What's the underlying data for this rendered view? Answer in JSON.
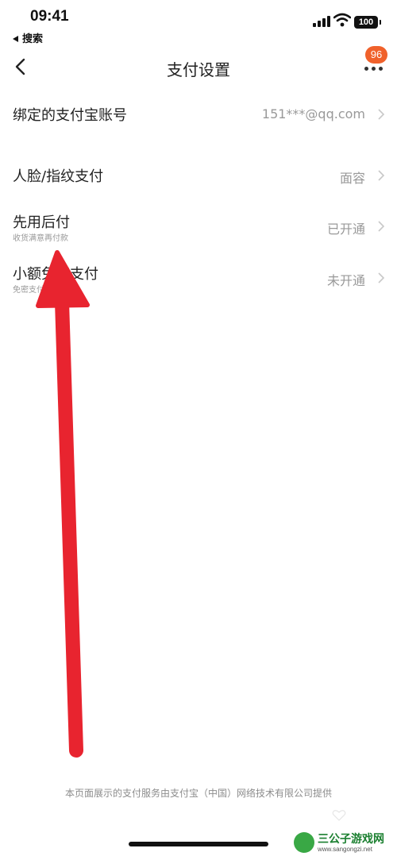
{
  "status_bar": {
    "time": "09:41",
    "back_app_label": "搜索",
    "battery_level": "100"
  },
  "nav": {
    "title": "支付设置",
    "badge_count": "96"
  },
  "settings": [
    {
      "label": "绑定的支付宝账号",
      "sub": "",
      "value": "151***@qq.com"
    },
    {
      "label": "人脸/指纹支付",
      "sub": "",
      "value": "面容"
    },
    {
      "label": "先用后付",
      "sub": "收货满意再付款",
      "value": "已开通"
    },
    {
      "label": "小额免密支付",
      "sub": "免密支付，少一步",
      "value": "未开通"
    }
  ],
  "footer": {
    "text": "本页面展示的支付服务由支付宝（中国）网络技术有限公司提供"
  },
  "watermark": {
    "name": "三公子游戏网",
    "url": "www.sangongzi.net"
  },
  "colors": {
    "badge": "#f0612b",
    "annotation_arrow": "#e8242f",
    "background": "#ffffff"
  }
}
